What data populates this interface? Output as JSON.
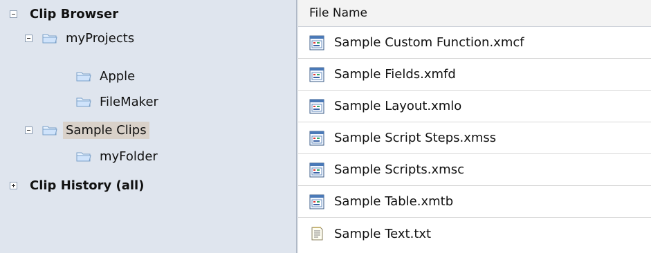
{
  "tree": {
    "items": [
      {
        "label": "Clip Browser",
        "icon": "minus-expander-icon"
      },
      {
        "label": "myProjects",
        "icon": "folder-icon"
      },
      {
        "label": "Apple",
        "icon": "folder-icon"
      },
      {
        "label": "FileMaker",
        "icon": "folder-icon"
      },
      {
        "label": "Sample Clips",
        "icon": "folder-icon",
        "selected": true
      },
      {
        "label": "myFolder",
        "icon": "folder-icon"
      },
      {
        "label": "Clip History (all)",
        "icon": "plus-expander-icon"
      }
    ]
  },
  "list": {
    "header": "File Name",
    "files": [
      {
        "name": "Sample Custom Function.xmcf",
        "icon": "clip-file-icon"
      },
      {
        "name": "Sample Fields.xmfd",
        "icon": "clip-file-icon"
      },
      {
        "name": "Sample Layout.xmlo",
        "icon": "clip-file-icon"
      },
      {
        "name": "Sample Script Steps.xmss",
        "icon": "clip-file-icon"
      },
      {
        "name": "Sample Scripts.xmsc",
        "icon": "clip-file-icon"
      },
      {
        "name": "Sample Table.xmtb",
        "icon": "clip-file-icon"
      },
      {
        "name": "Sample Text.txt",
        "icon": "text-file-icon"
      }
    ]
  }
}
